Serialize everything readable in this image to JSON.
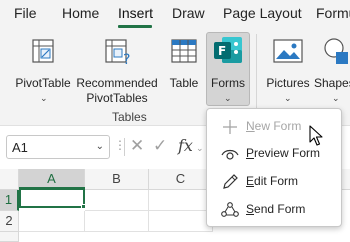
{
  "menubar": {
    "items": [
      "File",
      "Home",
      "Insert",
      "Draw",
      "Page Layout",
      "Formu"
    ],
    "active": "Insert"
  },
  "ribbon": {
    "pivottable": "PivotTable",
    "recommended_line1": "Recommended",
    "recommended_line2": "PivotTables",
    "table": "Table",
    "forms": "Forms",
    "pictures": "Pictures",
    "shapes": "Shapes",
    "group_label": "Tables"
  },
  "formula_bar": {
    "name_box": "A1",
    "fx": "fx"
  },
  "grid": {
    "columns": [
      "A",
      "B",
      "C"
    ],
    "rows": [
      "1",
      "2"
    ]
  },
  "forms_menu": {
    "items": [
      {
        "label_key": "N",
        "label_rest": "ew Form",
        "disabled": true,
        "icon": "plus-icon"
      },
      {
        "label_key": "P",
        "label_rest": "review Form",
        "disabled": false,
        "icon": "eye-icon"
      },
      {
        "label_key": "E",
        "label_rest": "dit Form",
        "disabled": false,
        "icon": "pencil-icon"
      },
      {
        "label_key": "S",
        "label_rest": "end Form",
        "disabled": false,
        "icon": "share-people-icon"
      }
    ]
  },
  "colors": {
    "accent": "#217346",
    "forms_brand": "#036C70",
    "ribbon_bg": "#f3f3f3",
    "disabled_text": "#a6a6a6"
  }
}
